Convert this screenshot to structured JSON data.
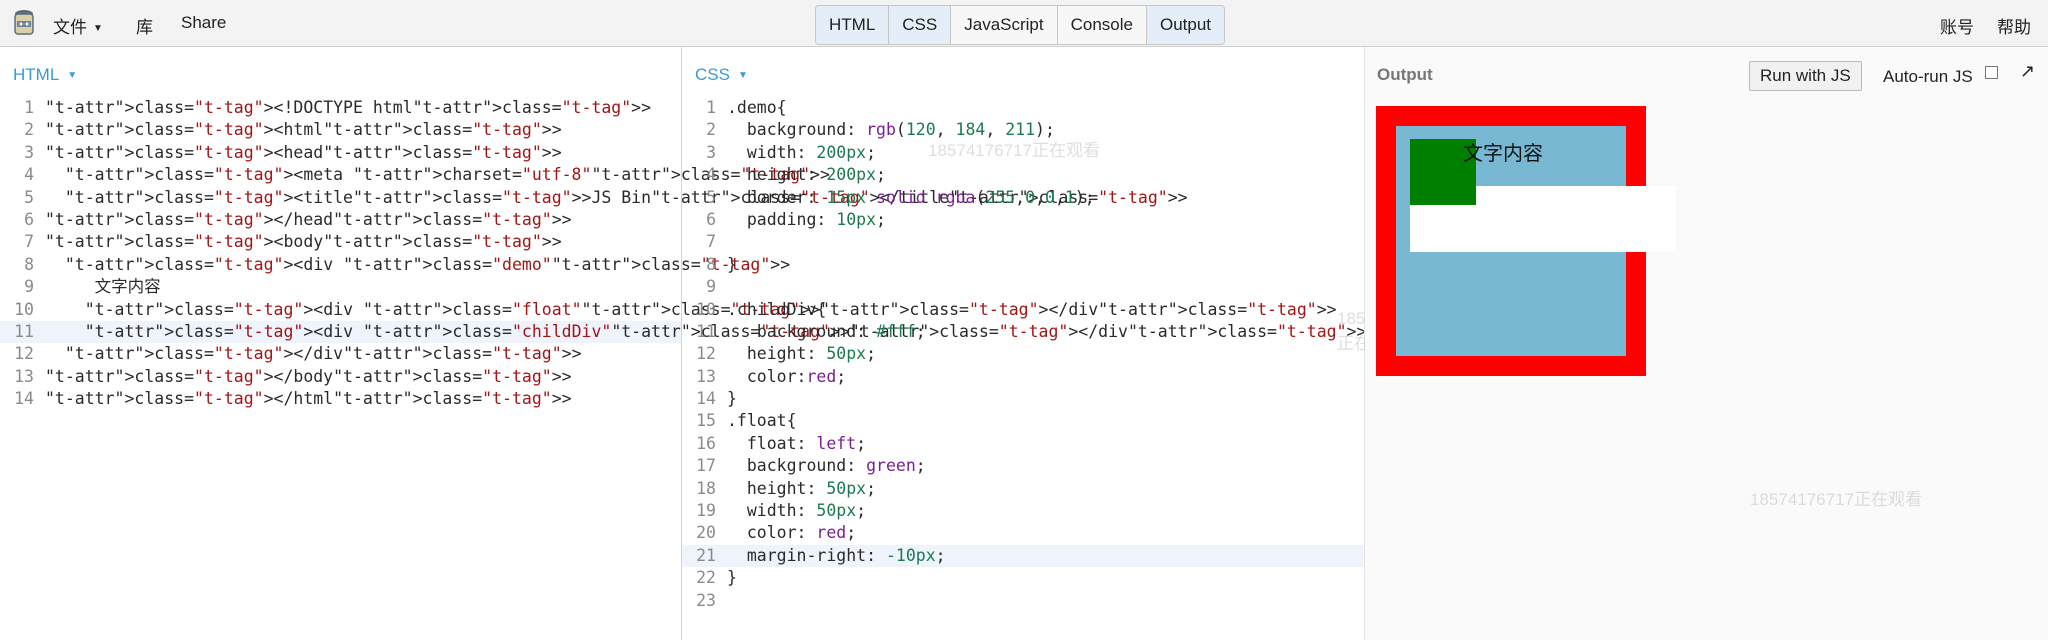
{
  "menu": {
    "file": "文件",
    "library": "库",
    "share": "Share",
    "account": "账号",
    "help": "帮助"
  },
  "tabs": [
    "HTML",
    "CSS",
    "JavaScript",
    "Console",
    "Output"
  ],
  "html_panel": {
    "label": "HTML",
    "lines": [
      "<!DOCTYPE html>",
      "<html>",
      "<head>",
      "  <meta charset=\"utf-8\">",
      "  <title>JS Bin</title>",
      "</head>",
      "<body>",
      "  <div class=\"demo\">",
      "     文字内容",
      "    <div class=\"float\"></div>",
      "    <div class=\"childDiv\"></div>",
      "  </div>",
      "</body>",
      "</html>"
    ],
    "highlight_line": 11
  },
  "css_panel": {
    "label": "CSS",
    "lines": [
      ".demo{",
      "  background: rgb(120, 184, 211);",
      "  width: 200px;",
      "  height: 200px;",
      "  border: 15px solid rgba(255,0,0,1);",
      "  padding: 10px;",
      "",
      "}",
      "",
      ".childDiv{",
      "   background: #fff;",
      "  height: 50px;",
      "  color:red;",
      "}",
      ".float{",
      "  float: left;",
      "  background: green;",
      "  height: 50px;",
      "  width: 50px;",
      "  color: red;",
      "  margin-right: -10px;",
      "}",
      ""
    ],
    "highlight_line": 21
  },
  "output_panel": {
    "label": "Output",
    "run_button": "Run with JS",
    "autorun_label": "Auto-run JS",
    "popout_icon": "↗",
    "demo_text": "文字内容"
  },
  "watermark": "18574176717正在观看",
  "colors": {
    "accent": "#3b9ad8",
    "demo_bg": "#78b8d3",
    "demo_border": "#ff0000",
    "float_bg": "#008000"
  }
}
